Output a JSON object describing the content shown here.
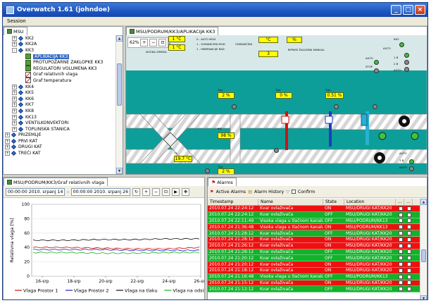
{
  "window": {
    "title": "Overwatch 1.61 (johndoe)",
    "min": "_",
    "max": "□",
    "close": "×"
  },
  "menu": {
    "session": "Session"
  },
  "tree": {
    "tab_label": "MSU",
    "items": [
      {
        "label": "KK2",
        "level": 2,
        "expander": "+",
        "icon": "diamond"
      },
      {
        "label": "KK2A",
        "level": 2,
        "expander": "+",
        "icon": "diamond"
      },
      {
        "label": "KK3",
        "level": 2,
        "expander": "-",
        "icon": "diamond"
      },
      {
        "label": "APLIKACIJA KK3",
        "level": 3,
        "expander": "",
        "icon": "network",
        "selected": true
      },
      {
        "label": "PROTUPOŽARNE ZAKLOPKE KK3",
        "level": 3,
        "expander": "",
        "icon": "network"
      },
      {
        "label": "REGULATORI VOLUMENA KK3",
        "level": 3,
        "expander": "",
        "icon": "network"
      },
      {
        "label": "Graf relativnih vlaga",
        "level": 3,
        "expander": "",
        "icon": "chart"
      },
      {
        "label": "Graf temperatura",
        "level": 3,
        "expander": "",
        "icon": "chart"
      },
      {
        "label": "KK4",
        "level": 2,
        "expander": "+",
        "icon": "diamond"
      },
      {
        "label": "KK5",
        "level": 2,
        "expander": "+",
        "icon": "diamond"
      },
      {
        "label": "KK6",
        "level": 2,
        "expander": "+",
        "icon": "diamond"
      },
      {
        "label": "KK7",
        "level": 2,
        "expander": "+",
        "icon": "diamond"
      },
      {
        "label": "KK8",
        "level": 2,
        "expander": "+",
        "icon": "diamond"
      },
      {
        "label": "KK13",
        "level": 2,
        "expander": "+",
        "icon": "diamond"
      },
      {
        "label": "VENTILKONVEKTORI",
        "level": 2,
        "expander": "+",
        "icon": "diamond"
      },
      {
        "label": "TOPLINSKA STANICA",
        "level": 2,
        "expander": "+",
        "icon": "diamond"
      },
      {
        "label": "PRIZEMLJE",
        "level": 1,
        "expander": "+",
        "icon": "diamond"
      },
      {
        "label": "PRVI KAT",
        "level": 1,
        "expander": "+",
        "icon": "diamond"
      },
      {
        "label": "DRUGI KAT",
        "level": 1,
        "expander": "+",
        "icon": "diamond"
      },
      {
        "label": "TREĆI KAT",
        "level": 1,
        "expander": "+",
        "icon": "diamond"
      }
    ]
  },
  "process": {
    "tab_label": "MSU/PODRUM/KK3/APLIKACIJA KK3",
    "zoom": "62%",
    "values": {
      "top1": "1 °C",
      "top2": "1 °C",
      "top3": "°C",
      "top4": "%",
      "top5": "3",
      "v_a": "2 %",
      "v_b": "0 %",
      "v_c": "0.51 %",
      "v_d": "2 %",
      "v_e": "98 %",
      "v_f": "19.7 °C",
      "v_g": "2 %"
    },
    "labels": {
      "l1": "KOMANDA SUSTAV",
      "l2": "NOĆNA ZIMSKA",
      "l3": "0 - AUTO MOD",
      "l4": "1 - OGRANIČENI MOD",
      "l5": "1 - HIBERNACIJE RAD",
      "l6": "OGRANIČENI",
      "l7": "BYPASS ŽALUZINA MANUAL",
      "l8": "AUTO",
      "l9": "STOP",
      "l10": "KK3",
      "l11": "AUTO",
      "l12": "1 B",
      "l13": "2 B",
      "l14": "AUTO",
      "l15": "T(s)",
      "l16": "T(s)",
      "l17": "T(s)",
      "l18": "RH",
      "l19": "T1",
      "l20": "T(s)",
      "l21": "AUTO",
      "l22": "1 B",
      "l23": "AUTO"
    }
  },
  "chart": {
    "tab_label": "MSU/PODRUM/KK3/Graf relativnih vlaga",
    "date_from": "00:00:00 2010. srpanj 14",
    "date_to": "00:00:00 2010. srpanj 26"
  },
  "chart_data": {
    "type": "line",
    "title": "",
    "xlabel": "",
    "ylabel": "Relativna vlaga [%]",
    "x": [
      "16-srp",
      "18-srp",
      "20-srp",
      "22-srp",
      "24-srp",
      "26-srp"
    ],
    "ylim": [
      0,
      100
    ],
    "yticks": [
      0,
      20,
      40,
      60,
      80,
      100
    ],
    "legend_position": "bottom",
    "series": [
      {
        "name": "Vlaga Prostor 1",
        "color": "#d01010",
        "values": [
          40,
          40,
          39,
          38,
          38,
          40
        ]
      },
      {
        "name": "Vlaga Prostor 2",
        "color": "#2020c8",
        "values": [
          37,
          37,
          37,
          36,
          36,
          36
        ]
      },
      {
        "name": "Vlaga na tlaku",
        "color": "#101010",
        "values": [
          50,
          50,
          51,
          51,
          52,
          52
        ]
      },
      {
        "name": "Vlaga na odsisu",
        "color": "#19b219",
        "values": [
          33,
          33,
          32,
          32,
          33,
          33
        ]
      }
    ]
  },
  "alarms": {
    "tab_label": "Alarms",
    "toolbar": {
      "active": "Active Alarms",
      "history": "Alarm History",
      "confirm": "Confirm"
    },
    "columns": [
      "Timestamp",
      "Name",
      "State",
      "Location"
    ],
    "rows": [
      {
        "ts": "2010.07.24 22:24:12",
        "name": "Kvar ovlaživača",
        "state": "ON",
        "loc": "MSU/DRUGI KAT/KK20",
        "color": "red"
      },
      {
        "ts": "2010.07.24 22:24:12",
        "name": "Kvar ovlaživača",
        "state": "OFF",
        "loc": "MSU/DRUGI KAT/KK20",
        "color": "green"
      },
      {
        "ts": "2010.07.24 22:11:49",
        "name": "Visoka vlaga u tlačnom kanalu",
        "state": "OFF",
        "loc": "MSU/PODRUM/KK13",
        "color": "green"
      },
      {
        "ts": "2010.07.24 21:36:48",
        "name": "Visoka vlaga u tlačnom kanalu",
        "state": "ON",
        "loc": "MSU/PODRUM/KK13",
        "color": "red"
      },
      {
        "ts": "2010.07.24 21:28:12",
        "name": "Kvar ovlaživača",
        "state": "OFF",
        "loc": "MSU/DRUGI KAT/KK20",
        "color": "green"
      },
      {
        "ts": "2010.07.24 21:28:12",
        "name": "Kvar ovlaživača",
        "state": "ON",
        "loc": "MSU/DRUGI KAT/KK20",
        "color": "red"
      },
      {
        "ts": "2010.07.24 21:26:12",
        "name": "Kvar ovlaživača",
        "state": "ON",
        "loc": "MSU/DRUGI KAT/KK20",
        "color": "red"
      },
      {
        "ts": "2010.07.24 21:28:12",
        "name": "Kvar ovlaživača",
        "state": "OFF",
        "loc": "MSU/DRUGI KAT/KK20",
        "color": "green"
      },
      {
        "ts": "2010.07.24 21:20:12",
        "name": "Kvar ovlaživača",
        "state": "OFF",
        "loc": "MSU/DRUGI KAT/KK20",
        "color": "green"
      },
      {
        "ts": "2010.07.24 21:20:12",
        "name": "Kvar ovlaživača",
        "state": "ON",
        "loc": "MSU/DRUGI KAT/KK20",
        "color": "red"
      },
      {
        "ts": "2010.07.24 21:18:12",
        "name": "Kvar ovlaživača",
        "state": "ON",
        "loc": "MSU/DRUGI KAT/KK20",
        "color": "red"
      },
      {
        "ts": "2010.07.24 21:16:48",
        "name": "Visoka vlaga u tlačnom kanalu",
        "state": "OFF",
        "loc": "MSU/PODRUM/KK13",
        "color": "green"
      },
      {
        "ts": "2010.07.24 21:15:12",
        "name": "Kvar ovlaživača",
        "state": "ON",
        "loc": "MSU/DRUGI KAT/KK20",
        "color": "red"
      },
      {
        "ts": "2010.07.24 21:12:12",
        "name": "Kvar ovlaživača",
        "state": "OFF",
        "loc": "MSU/DRUGI KAT/KK20",
        "color": "green"
      }
    ]
  }
}
